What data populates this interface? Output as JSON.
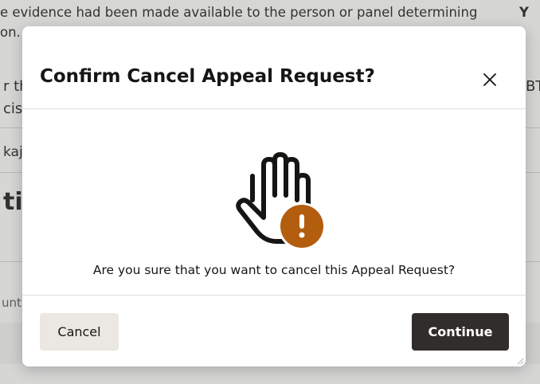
{
  "background": {
    "line1": "e evidence had been made available to the person or panel determining",
    "line1_right": "Y",
    "line2": "on.",
    "frag_th": "r th",
    "frag_cis": "cis",
    "frag_bt": "BT",
    "frag_kaj": "kaj",
    "frag_ti": "ti",
    "frag_unt": "unt"
  },
  "dialog": {
    "title": "Confirm Cancel Appeal Request?",
    "close_icon": "close-icon",
    "illustration_icon": "stop-hand-warning-icon",
    "message": "Are you sure that you want to cancel this Appeal Request?",
    "cancel_label": "Cancel",
    "continue_label": "Continue"
  },
  "colors": {
    "warning": "#b35d0f",
    "primary_button": "#312d2a",
    "secondary_button": "#ebe8e3",
    "text": "#161513"
  }
}
